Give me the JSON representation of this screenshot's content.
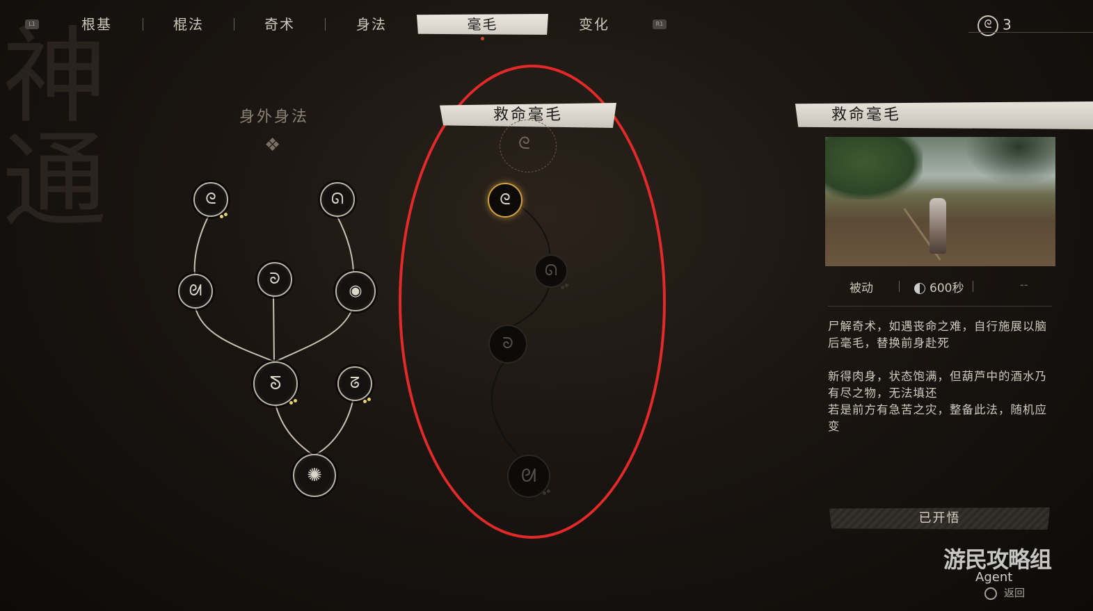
{
  "nav": {
    "left_button": "L1",
    "right_button": "R1",
    "tabs": [
      {
        "label": "根基"
      },
      {
        "label": "棍法"
      },
      {
        "label": "奇术"
      },
      {
        "label": "身法"
      },
      {
        "label": "毫毛"
      },
      {
        "label": "变化"
      }
    ],
    "active_tab": "毫毛",
    "spirit_count": "3"
  },
  "left_tree": {
    "title": "身外身法"
  },
  "middle_tree": {
    "title": "救命毫毛"
  },
  "details": {
    "title": "救命毫毛",
    "type": "被动",
    "cooldown": "600秒",
    "extra": "--",
    "description": [
      "尸解奇术，如遇丧命之难，自行施展以脑后毫毛，替换前身赴死",
      "新得肉身，状态饱满，但葫芦中的酒水乃有尽之物，无法填还",
      "若是前方有急苦之灾，整备此法，随机应变"
    ],
    "status_button": "已开悟"
  },
  "watermark": {
    "text": "游民攻略组",
    "agent": "Agent",
    "back_label": "返回"
  },
  "colors": {
    "highlight_oval": "#e22a2a",
    "active_node_ring": "#d1a040",
    "pip": "#e8d36a"
  }
}
